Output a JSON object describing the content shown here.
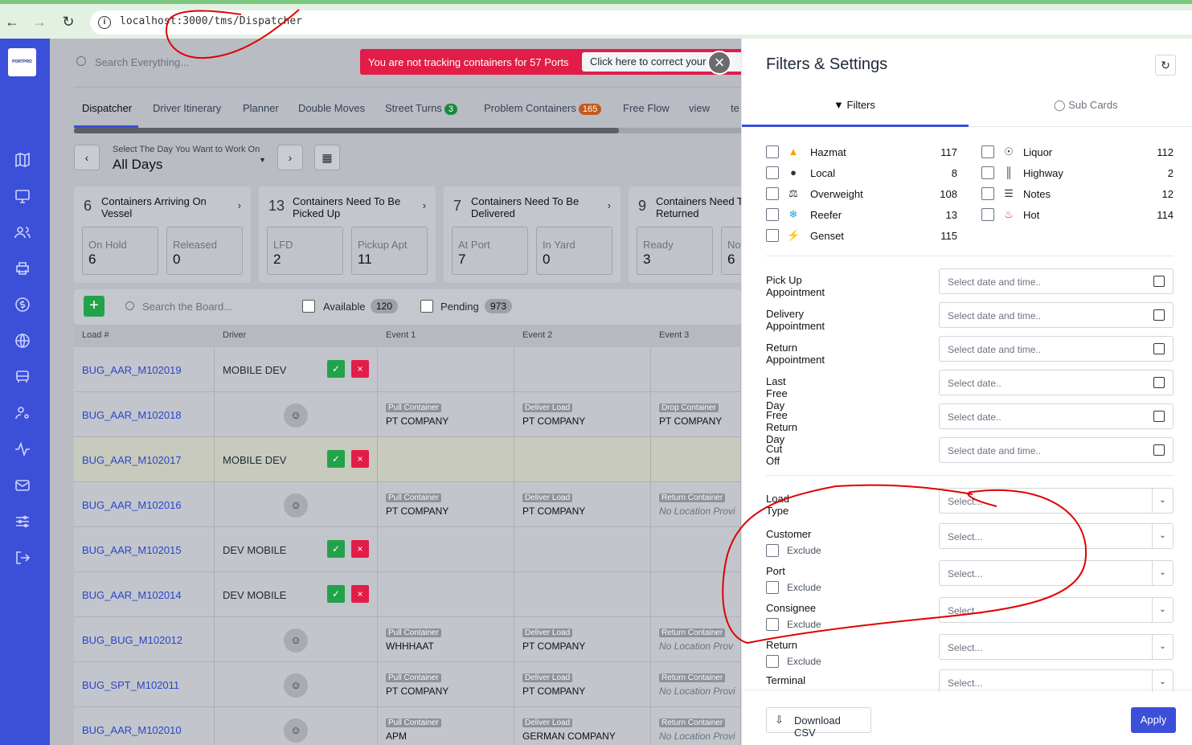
{
  "browser": {
    "url": "localhost:3000/tms/Dispatcher"
  },
  "app": {
    "logo_text": "PORTPRO",
    "search_placeholder": "Search Everything..."
  },
  "alert": {
    "message": "You are not tracking containers for 57 Ports",
    "button": "Click here to correct your cr"
  },
  "tabs": [
    {
      "label": "Dispatcher"
    },
    {
      "label": "Driver Itinerary"
    },
    {
      "label": "Planner"
    },
    {
      "label": "Double Moves"
    },
    {
      "label": "Street Turns",
      "badge": "3"
    },
    {
      "label": "Problem Containers",
      "badge": "165"
    },
    {
      "label": "Free Flow"
    },
    {
      "label": "view"
    },
    {
      "label": "te"
    }
  ],
  "day_picker": {
    "label": "Select The Day You Want to Work On",
    "value": "All Days"
  },
  "cards": [
    {
      "count": "6",
      "title": "Containers Arriving On Vessel",
      "subs": [
        {
          "label": "On Hold",
          "value": "6"
        },
        {
          "label": "Released",
          "value": "0"
        }
      ]
    },
    {
      "count": "13",
      "title": "Containers Need To Be Picked Up",
      "subs": [
        {
          "label": "LFD",
          "value": "2"
        },
        {
          "label": "Pickup Apt",
          "value": "11"
        }
      ]
    },
    {
      "count": "7",
      "title": "Containers Need To Be Delivered",
      "subs": [
        {
          "label": "At Port",
          "value": "7"
        },
        {
          "label": "In Yard",
          "value": "0"
        }
      ]
    },
    {
      "count": "9",
      "title": "Containers Need To Be Returned",
      "subs": [
        {
          "label": "Ready",
          "value": "3"
        },
        {
          "label": "No",
          "value": "6"
        }
      ]
    }
  ],
  "board": {
    "search_placeholder": "Search the Board...",
    "available_label": "Available",
    "available_count": "120",
    "pending_label": "Pending",
    "pending_count": "973"
  },
  "table": {
    "headers": [
      "Load #",
      "Driver",
      "Event 1",
      "Event 2",
      "Event 3"
    ],
    "rows": [
      {
        "load": "BUG_AAR_M102019",
        "driver": "MOBILE DEV",
        "events": []
      },
      {
        "load": "BUG_AAR_M102018",
        "driver": "",
        "events": [
          {
            "tag": "Pull Container",
            "name": "PT COMPANY"
          },
          {
            "tag": "Deliver Load",
            "name": "PT COMPANY"
          },
          {
            "tag": "Drop Container",
            "name": "PT COMPANY"
          }
        ]
      },
      {
        "load": "BUG_AAR_M102017",
        "driver": "MOBILE DEV",
        "events": []
      },
      {
        "load": "BUG_AAR_M102016",
        "driver": "",
        "events": [
          {
            "tag": "Pull Container",
            "name": "PT COMPANY"
          },
          {
            "tag": "Deliver Load",
            "name": "PT COMPANY"
          },
          {
            "tag": "Return Container",
            "name": "No Location Provi"
          }
        ]
      },
      {
        "load": "BUG_AAR_M102015",
        "driver": "DEV MOBILE",
        "events": []
      },
      {
        "load": "BUG_AAR_M102014",
        "driver": "DEV MOBILE",
        "events": []
      },
      {
        "load": "BUG_BUG_M102012",
        "driver": "",
        "events": [
          {
            "tag": "Pull Container",
            "name": "WHHHAAT"
          },
          {
            "tag": "Deliver Load",
            "name": "PT COMPANY"
          },
          {
            "tag": "Return Container",
            "name": "No Location Prov"
          }
        ]
      },
      {
        "load": "BUG_SPT_M102011",
        "driver": "",
        "events": [
          {
            "tag": "Pull Container",
            "name": "PT COMPANY"
          },
          {
            "tag": "Deliver Load",
            "name": "PT COMPANY"
          },
          {
            "tag": "Return Container",
            "name": "No Location Provi"
          }
        ]
      },
      {
        "load": "BUG_AAR_M102010",
        "driver": "",
        "events": [
          {
            "tag": "Pull Container",
            "name": "APM"
          },
          {
            "tag": "Deliver Load",
            "name": "GERMAN COMPANY"
          },
          {
            "tag": "Return Container",
            "name": "No Location Provi"
          }
        ]
      }
    ]
  },
  "panel": {
    "title": "Filters & Settings",
    "tab_filters": "Filters",
    "tab_subcards": "Sub Cards",
    "flags_left": [
      {
        "label": "Hazmat",
        "count": "117",
        "icon": "warning-icon"
      },
      {
        "label": "Local",
        "count": "8",
        "icon": "map-pin-icon"
      },
      {
        "label": "Overweight",
        "count": "108",
        "icon": "weight-icon"
      },
      {
        "label": "Reefer",
        "count": "13",
        "icon": "snowflake-icon"
      },
      {
        "label": "Genset",
        "count": "115",
        "icon": "bolt-icon"
      }
    ],
    "flags_right": [
      {
        "label": "Liquor",
        "count": "112",
        "icon": "liquor-icon"
      },
      {
        "label": "Highway",
        "count": "2",
        "icon": "highway-icon"
      },
      {
        "label": "Notes",
        "count": "12",
        "icon": "notes-icon"
      },
      {
        "label": "Hot",
        "count": "114",
        "icon": "fire-icon"
      }
    ],
    "date_filters": [
      {
        "label": "Pick Up Appointment",
        "placeholder": "Select date and time.."
      },
      {
        "label": "Delivery Appointment",
        "placeholder": "Select date and time.."
      },
      {
        "label": "Return Appointment",
        "placeholder": "Select date and time.."
      },
      {
        "label": "Last Free Day",
        "placeholder": "Select date.."
      },
      {
        "label": "Free Return Day",
        "placeholder": "Select date.."
      },
      {
        "label": "Cut Off",
        "placeholder": "Select date and time.."
      }
    ],
    "select_filters": [
      {
        "label": "Load Type",
        "placeholder": "Select...",
        "exclude": ""
      },
      {
        "label": "Customer",
        "placeholder": "Select...",
        "exclude": "Exclude"
      },
      {
        "label": "Port",
        "placeholder": "Select...",
        "exclude": "Exclude"
      },
      {
        "label": "Consignee",
        "placeholder": "Select...",
        "exclude": "Exclude"
      },
      {
        "label": "Return",
        "placeholder": "Select...",
        "exclude": "Exclude"
      },
      {
        "label": "Terminal",
        "placeholder": "Select...",
        "exclude": ""
      }
    ],
    "download_csv": "Download CSV",
    "apply": "Apply"
  },
  "colors": {
    "brand": "#3b4fd8",
    "alert": "#e11d48",
    "success": "#22a34a",
    "annotation": "#e00000"
  }
}
